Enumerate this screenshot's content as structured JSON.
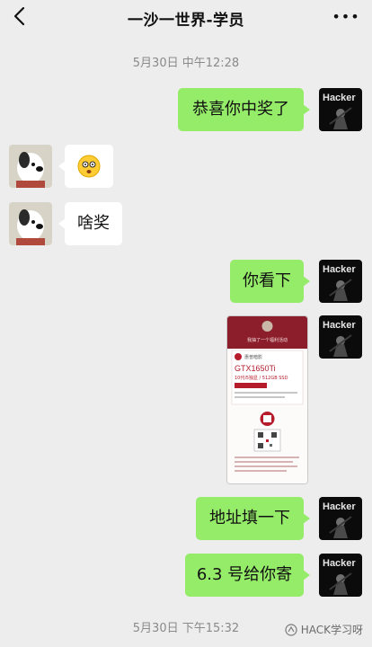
{
  "header": {
    "title": "一沙一世界-学员",
    "more_label": "•••"
  },
  "timestamps": {
    "first": "5月30日 中午12:28",
    "second": "5月30日 下午15:32"
  },
  "messages": [
    {
      "from": "me",
      "text": "恭喜你中奖了"
    },
    {
      "from": "them",
      "emoji": "dizzy-face-emoji"
    },
    {
      "from": "them",
      "text": "啥奖"
    },
    {
      "from": "me",
      "text": "你看下"
    },
    {
      "from": "me",
      "image": "prize-share-screenshot"
    },
    {
      "from": "me",
      "text": "地址填一下"
    },
    {
      "from": "me",
      "text": "6.3 号给你寄"
    }
  ],
  "avatars": {
    "me": {
      "label": "Hacker"
    }
  },
  "screenshot": {
    "header_line": "我抽了一个福利活动",
    "brand": "惠普暗影",
    "product_line1": "GTX1650Ti",
    "product_line2": "10代i5独显 / 512GB SSD"
  },
  "watermark": {
    "text": "HACK学习呀"
  },
  "colors": {
    "background": "#ededed",
    "bubble_out": "#95ec69",
    "bubble_in": "#ffffff",
    "accent_red": "#b61b2b"
  }
}
